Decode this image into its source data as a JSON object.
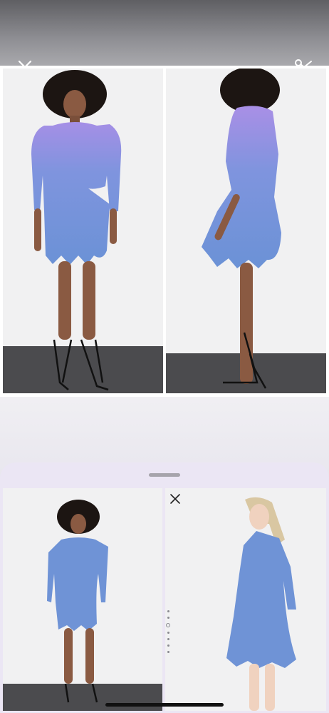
{
  "toolbar": {
    "close_icon": "close-icon",
    "crop_icon": "scissors-icon"
  },
  "top_images": [
    {
      "name": "model-front-view",
      "pose": "front"
    },
    {
      "name": "model-side-view",
      "pose": "side"
    }
  ],
  "sheet": {
    "images": [
      {
        "name": "result-front-view",
        "pose": "front"
      },
      {
        "name": "result-blonde-model",
        "pose": "three-quarter"
      }
    ],
    "close_icon": "close-icon",
    "page_dots": 7,
    "active_dot": 2
  },
  "colors": {
    "dress_blue": "#6f93d6",
    "dress_purple": "#a78ee6",
    "floor": "#4b4b4e",
    "sheet_bg": "#ebe6f4"
  }
}
